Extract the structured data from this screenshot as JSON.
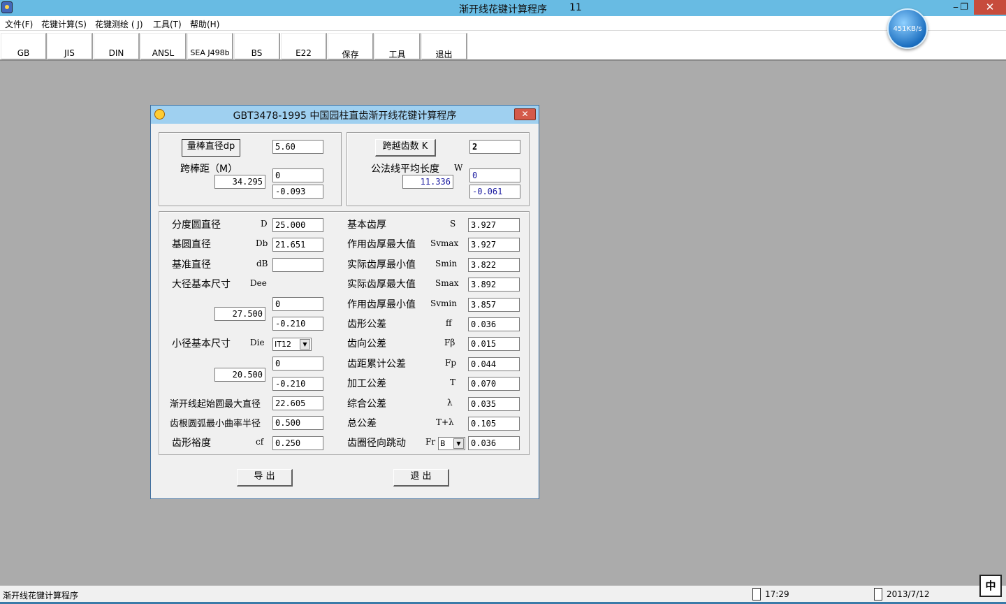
{
  "window": {
    "title": "渐开线花键计算程序",
    "title_num": "11",
    "minimize": "⎯",
    "restore": "❐",
    "close": "✕"
  },
  "menu": [
    "文件(F)",
    "花键计算(S)",
    "花键测绘 ( J)",
    "工具(T)",
    "帮助(H)"
  ],
  "toolbar": [
    "GB",
    "JIS",
    "DIN",
    "ANSL",
    "SEA J498b",
    "BS",
    "E22",
    "保存",
    "工具",
    "退出"
  ],
  "net_speed": "451KB/s",
  "dialog": {
    "title": "GBT3478-1995 中国园柱直齿渐开线花键计算程序",
    "close": "✕",
    "top_left": {
      "button": "量棒直径dp",
      "dp": "5.60",
      "label": "跨棒距（M）",
      "value": "34.295",
      "upper": "0",
      "lower": "-0.093"
    },
    "top_right": {
      "button": "跨越齿数 K",
      "k": "2",
      "label": "公法线平均长度",
      "symbol": "W",
      "value": "11.336",
      "upper": "0",
      "lower": "-0.061"
    },
    "left": {
      "pitch_dia": {
        "label": "分度圆直径",
        "sym": "D",
        "value": "25.000"
      },
      "base_dia": {
        "label": "基圆直径",
        "sym": "Db",
        "value": "21.651"
      },
      "ref_dia": {
        "label": "基准直径",
        "sym": "dB",
        "value": ""
      },
      "major": {
        "label": "大径基本尺寸",
        "sym": "Dee",
        "value": "27.500",
        "upper": "0",
        "lower": "-0.210"
      },
      "minor": {
        "label": "小径基本尺寸",
        "sym": "Die",
        "grade": "IT12",
        "value": "20.500",
        "upper": "0",
        "lower": "-0.210"
      },
      "form_dia": {
        "label": "渐开线起始圆最大直径",
        "value": "22.605"
      },
      "root_radius": {
        "label": "齿根圆弧最小曲率半径",
        "value": "0.500"
      },
      "form_clear": {
        "label": "齿形裕度",
        "sym": "cf",
        "value": "0.250"
      }
    },
    "right": [
      {
        "label": "基本齿厚",
        "sym": "S",
        "value": "3.927"
      },
      {
        "label": "作用齿厚最大值",
        "sym": "Svmax",
        "value": "3.927"
      },
      {
        "label": "实际齿厚最小值",
        "sym": "Smin",
        "value": "3.822"
      },
      {
        "label": "实际齿厚最大值",
        "sym": "Smax",
        "value": "3.892"
      },
      {
        "label": "作用齿厚最小值",
        "sym": "Svmin",
        "value": "3.857"
      },
      {
        "label": "齿形公差",
        "sym": "ff",
        "value": "0.036"
      },
      {
        "label": "齿向公差",
        "sym": "Fβ",
        "value": "0.015"
      },
      {
        "label": "齿距累计公差",
        "sym": "Fp",
        "value": "0.044"
      },
      {
        "label": "加工公差",
        "sym": "T",
        "value": "0.070"
      },
      {
        "label": "综合公差",
        "sym": "λ",
        "value": "0.035"
      },
      {
        "label": "总公差",
        "sym": "T+λ",
        "value": "0.105"
      },
      {
        "label": "齿圈径向跳动",
        "sym": "Fr",
        "grade": "B",
        "value": "0.036"
      }
    ],
    "export": "导 出",
    "exit": "退 出"
  },
  "status": {
    "text": "渐开线花键计算程序",
    "time": "17:29",
    "date": "2013/7/12",
    "ime": "中"
  },
  "colors": {
    "titlebar": "#68bbe3",
    "workspace": "#ababab",
    "close": "#c74c3c"
  }
}
